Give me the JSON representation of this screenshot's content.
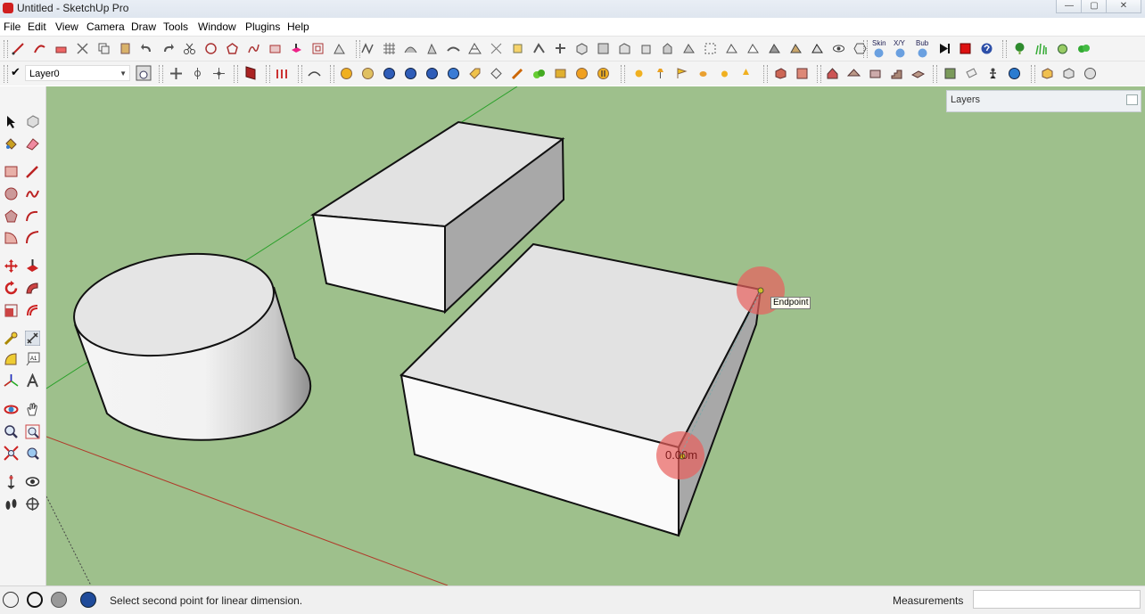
{
  "window": {
    "title": "Untitled - SketchUp Pro",
    "minimize_glyph": "—",
    "maximize_glyph": "▢",
    "close_glyph": "✕"
  },
  "menu": [
    "File",
    "Edit",
    "View",
    "Camera",
    "Draw",
    "Tools",
    "Window",
    "Plugins",
    "Help"
  ],
  "toolbar": {
    "layer_value": "Layer0",
    "skin_label": "Skin",
    "xy_label": "X/Y",
    "bub_label": "Bub"
  },
  "layers_panel": {
    "title": "Layers"
  },
  "viewport": {
    "tooltip": "Endpoint",
    "dimension_text": "0.00m",
    "background_color": "#9ec08c"
  },
  "status": {
    "message": "Select second point for linear dimension.",
    "measurements_label": "Measurements",
    "measurements_value": ""
  },
  "colors": {
    "accent_red": "#d02020",
    "axis_green": "#2aa02a",
    "axis_red": "#b03a2a",
    "inference_highlight": "#e8605c"
  }
}
